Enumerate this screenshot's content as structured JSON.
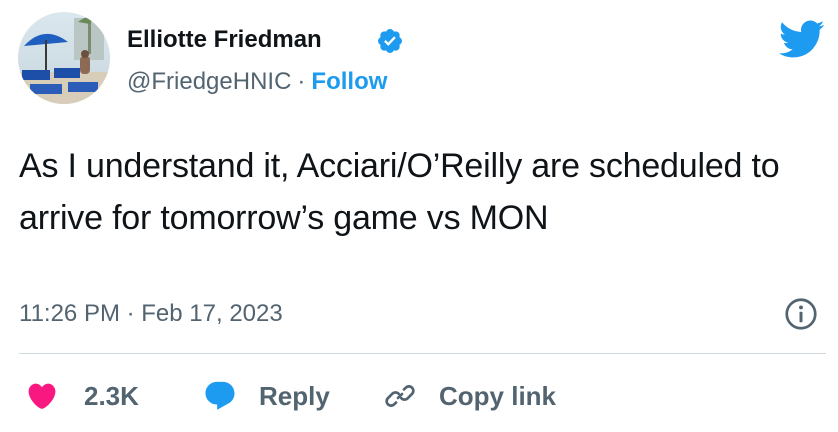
{
  "author": {
    "name": "Elliotte Friedman",
    "handle": "@FriedgeHNIC",
    "separator": "·",
    "follow_label": "Follow",
    "verified": true,
    "avatar": "profile-photo-beach-umbrellas"
  },
  "tweet": {
    "text": "As I understand it, Acciari/O’Reilly are scheduled to arrive for tomorrow’s game vs MON",
    "timestamp": "11:26 PM · Feb 17, 2023"
  },
  "actions": {
    "like_count": "2.3K",
    "reply_label": "Reply",
    "copy_link_label": "Copy link"
  },
  "icons": {
    "brand": "twitter-bird-icon",
    "verified": "verified-badge-icon",
    "info": "info-icon",
    "like": "heart-icon",
    "reply": "speech-bubble-icon",
    "copy": "link-icon"
  },
  "colors": {
    "brand_blue": "#1d9bf0",
    "like_pink": "#f91880",
    "text_primary": "#0f1419",
    "text_secondary": "#536471",
    "divider": "#cfd9de"
  }
}
